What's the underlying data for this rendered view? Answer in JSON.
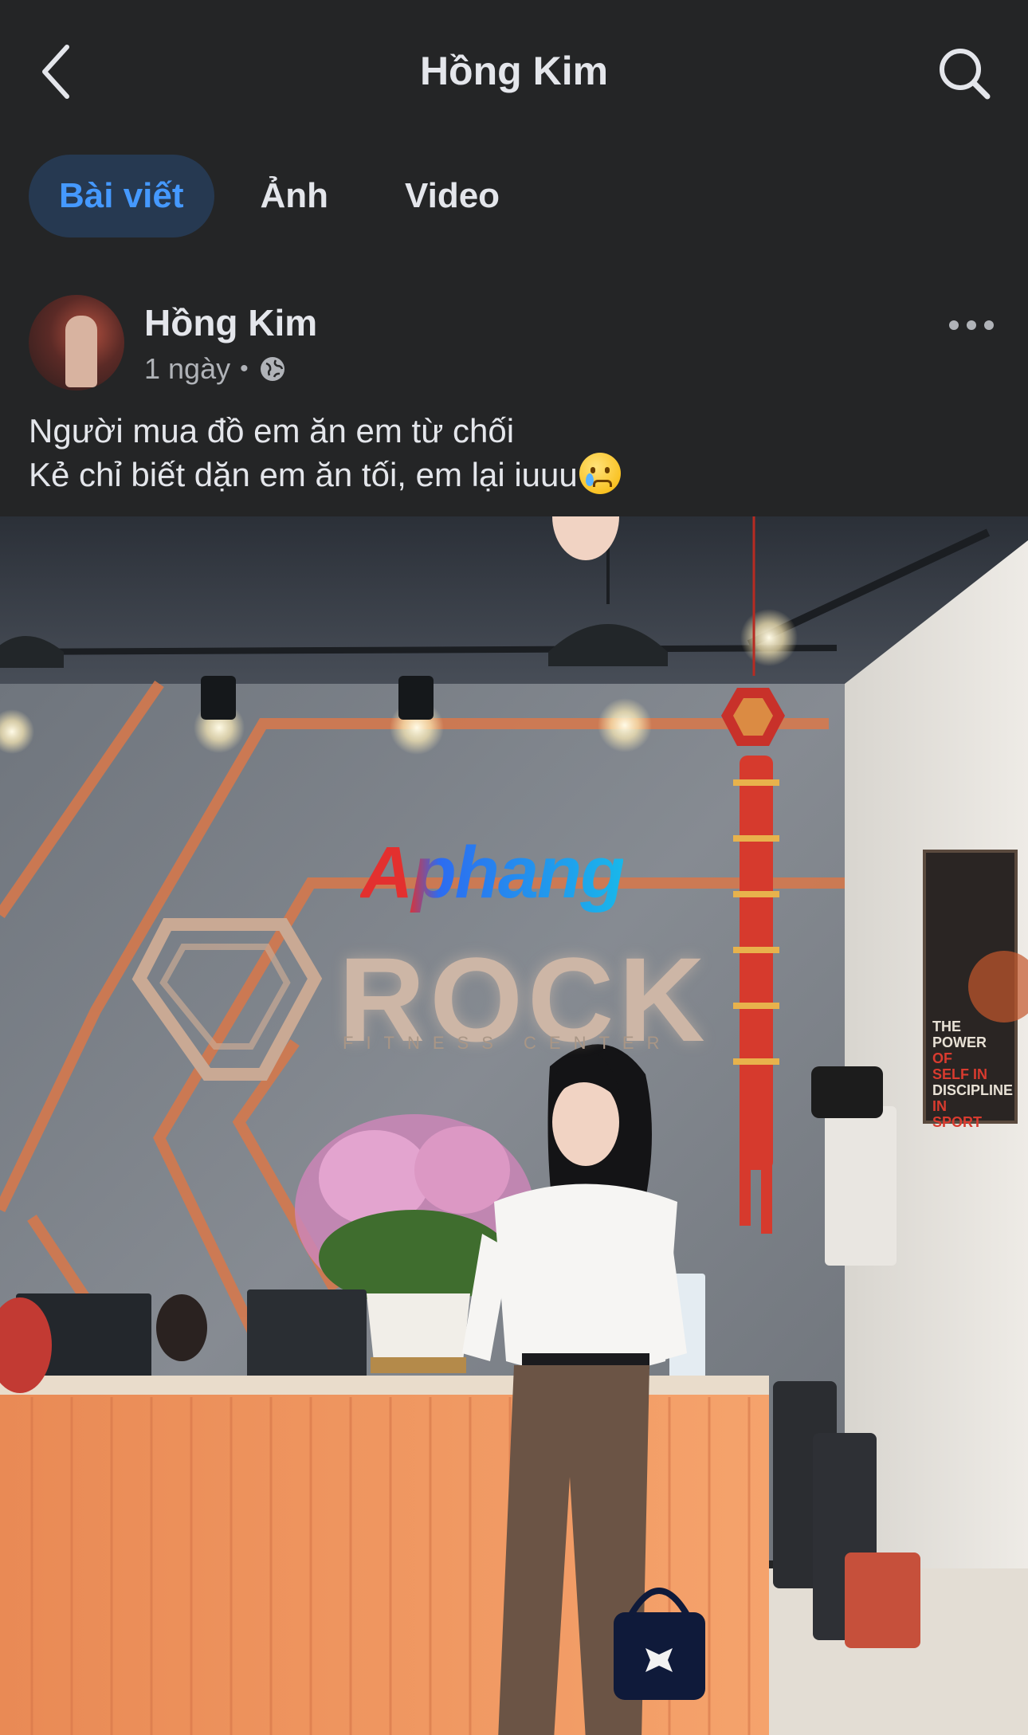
{
  "header": {
    "title": "Hồng Kim",
    "back_icon": "chevron-left-icon",
    "search_icon": "search-icon"
  },
  "tabs": [
    {
      "label": "Bài viết",
      "active": true
    },
    {
      "label": "Ảnh",
      "active": false
    },
    {
      "label": "Video",
      "active": false
    }
  ],
  "post": {
    "author": "Hồng Kim",
    "time": "1 ngày",
    "separator": "•",
    "privacy_icon": "globe-icon",
    "more_icon": "more-horizontal-icon",
    "caption_line1": "Người mua đồ em ăn em từ chối",
    "caption_line2": "Kẻ chỉ biết dặn em ăn tối, em lại iuuu",
    "caption_emoji": "crying-face-emoji",
    "photo": {
      "watermark": "Aphang",
      "sign_text": "ROCK",
      "sign_subtext": "FITNESS CENTER",
      "poster_line1": "THE POWER",
      "poster_line2": "OF SELF IN",
      "poster_line3": "DISCIPLINE",
      "poster_line4": "IN SPORT"
    }
  },
  "colors": {
    "background": "#242526",
    "active_tab_bg": "#263951",
    "active_tab_text": "#4599ff",
    "secondary_text": "#b0b3b8"
  }
}
